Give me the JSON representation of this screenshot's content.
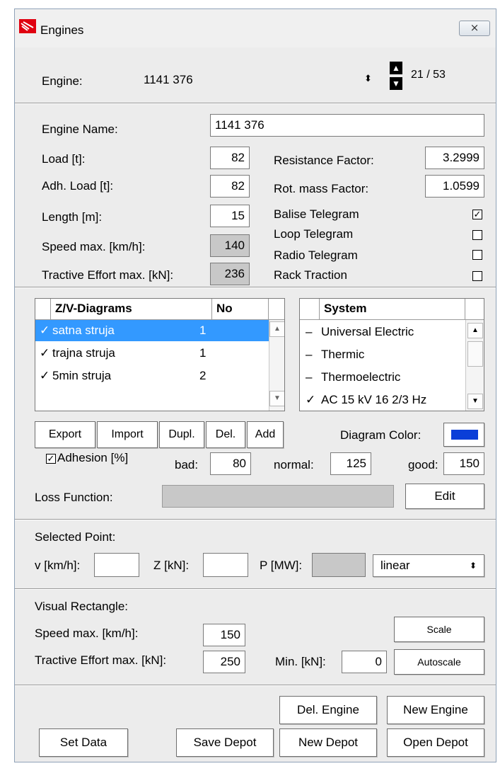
{
  "window": {
    "title": "Engines",
    "close_glyph": "⨯"
  },
  "engine_selector": {
    "label": "Engine:",
    "value": "1141 376",
    "counter": "21 / 53"
  },
  "details": {
    "engine_name_label": "Engine Name:",
    "engine_name_value": "1141 376",
    "load_label": "Load [t]:",
    "load_value": "82",
    "adh_load_label": "Adh. Load [t]:",
    "adh_load_value": "82",
    "length_label": "Length [m]:",
    "length_value": "15",
    "speed_max_label": "Speed max. [km/h]:",
    "speed_max_value": "140",
    "tractive_label": "Tractive Effort max. [kN]:",
    "tractive_value": "236",
    "resistance_label": "Resistance Factor:",
    "resistance_value": "3.2999",
    "rot_mass_label": "Rot. mass Factor:",
    "rot_mass_value": "1.0599",
    "balise_label": "Balise Telegram",
    "balise_checked": true,
    "loop_label": "Loop Telegram",
    "loop_checked": false,
    "radio_label": "Radio Telegram",
    "radio_checked": false,
    "rack_label": "Rack Traction",
    "rack_checked": false
  },
  "diagrams": {
    "header_name": "Z/V-Diagrams",
    "header_no": "No",
    "rows": [
      {
        "mark": "✓",
        "name": "satna struja",
        "no": "1",
        "selected": true
      },
      {
        "mark": "✓",
        "name": "trajna struja",
        "no": "1",
        "selected": false
      },
      {
        "mark": "✓",
        "name": "5min struja",
        "no": "2",
        "selected": false
      }
    ]
  },
  "systems": {
    "header": "System",
    "rows": [
      {
        "mark": "–",
        "name": "Universal Electric"
      },
      {
        "mark": "–",
        "name": "Thermic"
      },
      {
        "mark": "–",
        "name": "Thermoelectric"
      },
      {
        "mark": "✓",
        "name": "AC 15 kV 16 2/3 Hz"
      }
    ]
  },
  "diagram_buttons": {
    "export": "Export",
    "import": "Import",
    "dupl": "Dupl.",
    "del": "Del.",
    "add": "Add"
  },
  "diagram_color": {
    "label": "Diagram Color:",
    "color": "#0a3ed8"
  },
  "adhesion": {
    "label": "Adhesion [%]",
    "checked": true,
    "bad_label": "bad:",
    "bad_value": "80",
    "normal_label": "normal:",
    "normal_value": "125",
    "good_label": "good:",
    "good_value": "150"
  },
  "loss_function": {
    "label": "Loss Function:",
    "edit": "Edit"
  },
  "selected_point": {
    "title": "Selected Point:",
    "v_label": "v [km/h]:",
    "z_label": "Z [kN]:",
    "p_label": "P [MW]:",
    "interp": "linear"
  },
  "visual_rect": {
    "title": "Visual Rectangle:",
    "speed_label": "Speed max. [km/h]:",
    "speed_value": "150",
    "tractive_label": "Tractive Effort max. [kN]:",
    "tractive_value": "250",
    "min_label": "Min. [kN]:",
    "min_value": "0",
    "scale": "Scale",
    "autoscale": "Autoscale"
  },
  "footer": {
    "del_engine": "Del. Engine",
    "new_engine": "New Engine",
    "set_data": "Set Data",
    "save_depot": "Save Depot",
    "new_depot": "New Depot",
    "open_depot": "Open Depot"
  }
}
